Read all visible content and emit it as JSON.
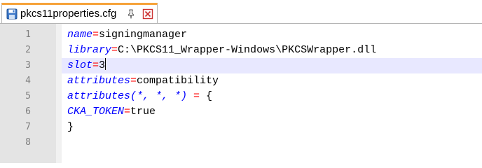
{
  "tab": {
    "title": "pkcs11properties.cfg",
    "icons": {
      "file": "file-save-icon",
      "pin": "pin-icon",
      "close": "close-icon"
    },
    "accent_color": "#f6a33a",
    "close_color": "#cc3333"
  },
  "editor": {
    "colors": {
      "key": "#0000ff",
      "operator": "#ff0000",
      "value": "#000000",
      "line_number": "#808080",
      "gutter": "#e4e4e4",
      "current_line": "#e8e8ff"
    },
    "lines": [
      {
        "number": "1",
        "key": "name",
        "op": "=",
        "value": "signingmanager"
      },
      {
        "number": "2",
        "key": "library",
        "op": "=",
        "value": "C:\\PKCS11_Wrapper-Windows\\PKCSWrapper.dll"
      },
      {
        "number": "3",
        "key": "slot",
        "op": "=",
        "value": "3"
      },
      {
        "number": "4",
        "key": "attributes",
        "op": "=",
        "value": "compatibility"
      },
      {
        "number": "5",
        "key": "attributes(*, *, *)",
        "op": " = ",
        "value": "{"
      },
      {
        "number": "6",
        "key": "CKA_TOKEN",
        "op": "=",
        "value": "true"
      },
      {
        "number": "7",
        "key": "",
        "op": "",
        "value": "}"
      },
      {
        "number": "8",
        "key": "",
        "op": "",
        "value": ""
      }
    ]
  }
}
